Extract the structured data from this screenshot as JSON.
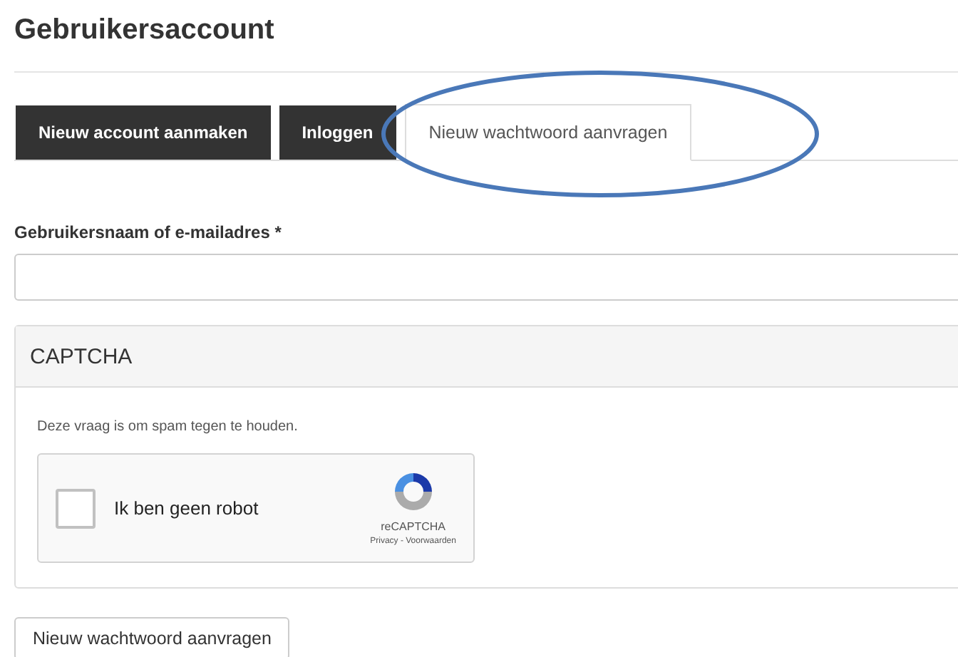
{
  "page_title": "Gebruikersaccount",
  "tabs": [
    {
      "label": "Nieuw account aanmaken",
      "selected": false
    },
    {
      "label": "Inloggen",
      "selected": false
    },
    {
      "label": "Nieuw wachtwoord aanvragen",
      "selected": true
    }
  ],
  "username_field": {
    "label": "Gebruikersnaam of e-mailadres *"
  },
  "captcha": {
    "title": "CAPTCHA",
    "description": "Deze vraag is om spam tegen te houden.",
    "checkbox_label": "Ik ben geen robot",
    "checked": false,
    "brand": "reCAPTCHA",
    "links": "Privacy - Voorwaarden"
  },
  "submit_button": "Nieuw wachtwoord aanvragen",
  "annotation": {
    "kind": "ellipse"
  }
}
